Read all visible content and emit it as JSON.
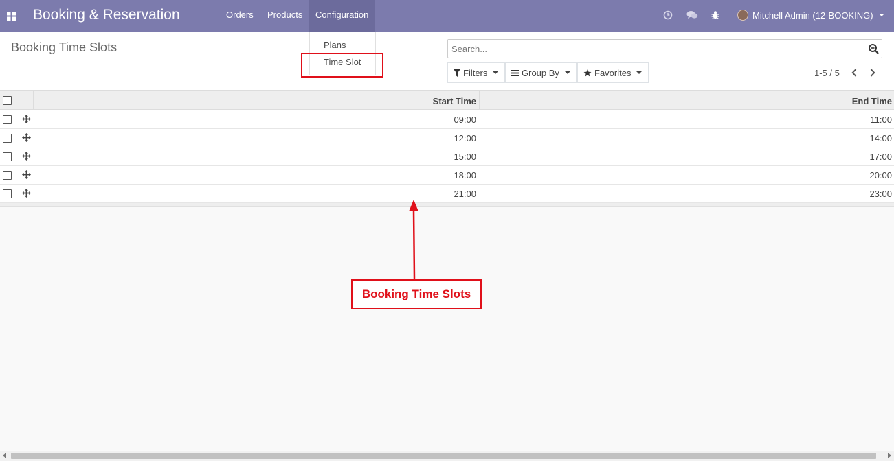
{
  "navbar": {
    "brand": "Booking & Reservation",
    "menu": [
      "Orders",
      "Products",
      "Configuration"
    ],
    "user": "Mitchell Admin (12-BOOKING)",
    "icons": [
      "apps-icon",
      "clock-icon",
      "chat-icon",
      "bug-icon"
    ]
  },
  "config_dropdown": {
    "items": [
      "Plans",
      "Time Slot"
    ]
  },
  "control_panel": {
    "title": "Booking Time Slots",
    "search_placeholder": "Search...",
    "filters": "Filters",
    "group_by": "Group By",
    "favorites": "Favorites",
    "pager": "1-5 / 5"
  },
  "table": {
    "headers": [
      "Start Time",
      "End Time"
    ],
    "rows": [
      [
        "09:00",
        "11:00"
      ],
      [
        "12:00",
        "14:00"
      ],
      [
        "15:00",
        "17:00"
      ],
      [
        "18:00",
        "20:00"
      ],
      [
        "21:00",
        "23:00"
      ]
    ]
  },
  "annotation": {
    "label": "Booking Time Slots",
    "color": "#e0101a"
  },
  "colors": {
    "navbar": "#7c7bad",
    "annotation": "#e0101a"
  }
}
